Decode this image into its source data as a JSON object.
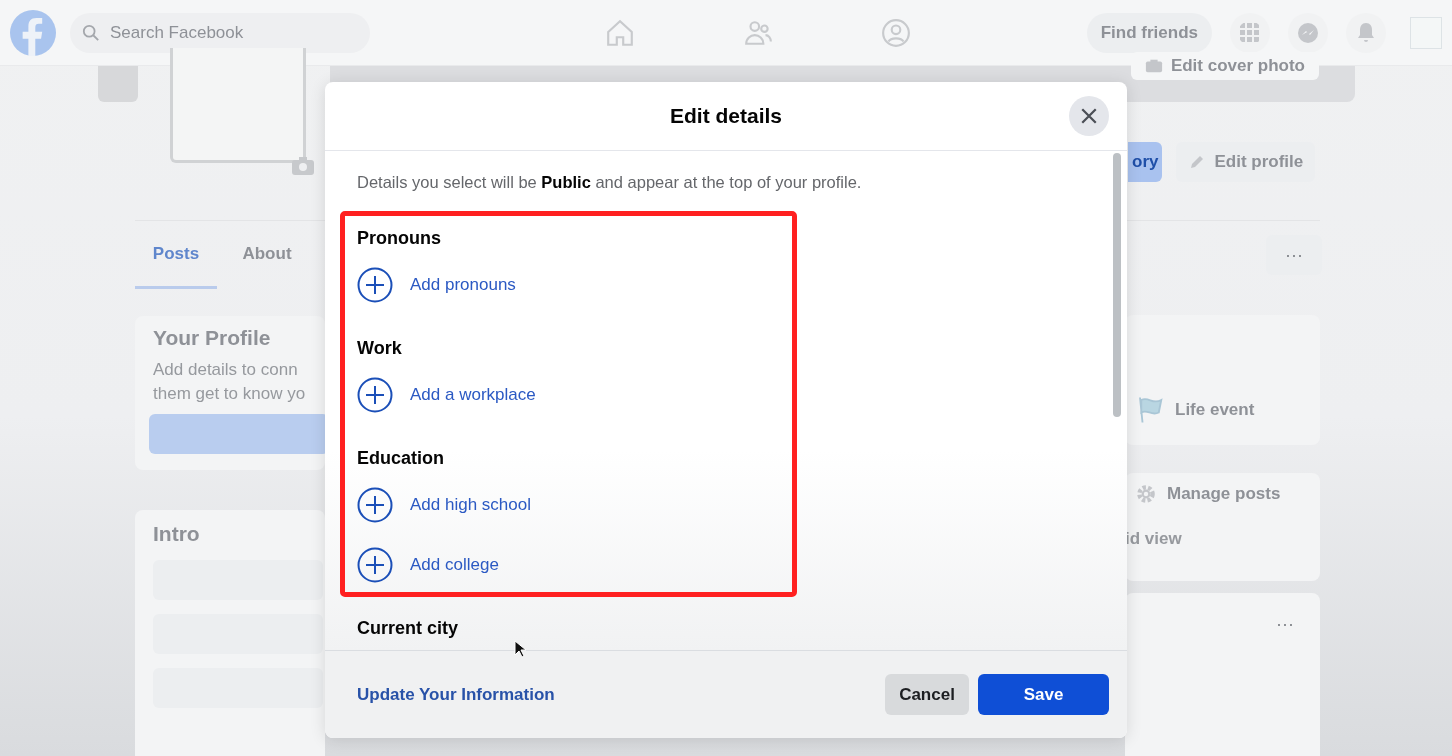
{
  "topbar": {
    "search": {
      "placeholder": "Search Facebook"
    },
    "find_friends": "Find friends"
  },
  "profile": {
    "cover_button": "Edit cover photo",
    "story_button": "ory",
    "edit_button": "Edit profile",
    "tabs": [
      {
        "label": "Posts",
        "selected": true
      },
      {
        "label": "About",
        "selected": false
      }
    ]
  },
  "left_cards": {
    "your_profile": {
      "title": "Your Profile",
      "text_lines": [
        "Add details to conn",
        "them get to know yo"
      ]
    },
    "intro": {
      "title": "Intro"
    }
  },
  "profile_more": "···",
  "right_cards": {
    "life_event": "Life event",
    "manage_posts": "Manage posts",
    "view_option": "id view",
    "post_more": "···"
  },
  "dialog": {
    "title": "Edit details",
    "notice": "Details you select will be **Public** and appear at the top of your profile.",
    "sections": [
      {
        "heading": "Pronouns",
        "highlighted": true,
        "actions": [
          "Add pronouns"
        ]
      },
      {
        "heading": "Work",
        "highlighted": true,
        "actions": [
          "Add a workplace"
        ]
      },
      {
        "heading": "Education",
        "highlighted": true,
        "actions": [
          "Add high school",
          "Add college"
        ]
      },
      {
        "heading": "Current city",
        "highlighted": false
      }
    ],
    "footer_link": "Update Your Information",
    "buttons": [
      {
        "label": "Cancel",
        "kind": "secondary"
      },
      {
        "label": "Save",
        "kind": "primary"
      }
    ]
  }
}
